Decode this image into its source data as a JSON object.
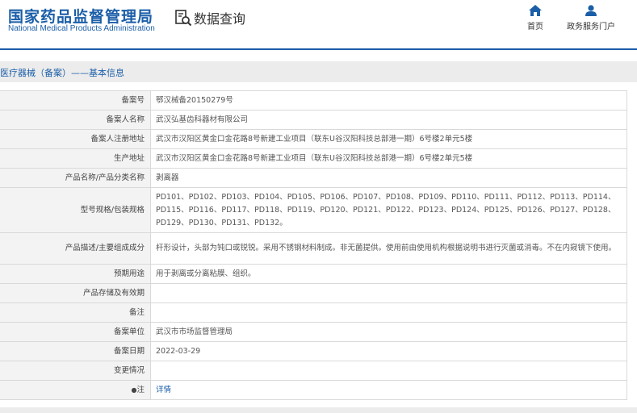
{
  "header": {
    "logo_cn": "国家药品监督管理局",
    "logo_en": "National Medical Products Administration",
    "query_label": "数据查询",
    "nav": [
      {
        "label": "首页",
        "icon": "home-icon"
      },
      {
        "label": "政务服务门户",
        "icon": "user-icon"
      }
    ]
  },
  "breadcrumb": "医疗器械（备案）——基本信息",
  "colors": {
    "brand_blue": "#1b5ea8",
    "label_bg": "#f3f3f3",
    "bar_bg": "#ececec"
  },
  "record": {
    "rows": [
      {
        "label": "备案号",
        "value": "鄂汉械备20150279号"
      },
      {
        "label": "备案人名称",
        "value": "武汉弘基齿科器材有限公司"
      },
      {
        "label": "备案人注册地址",
        "value": "武汉市汉阳区黄金口金花路8号新建工业项目（联东U谷汉阳科技总部港一期）6号楼2单元5楼"
      },
      {
        "label": "生产地址",
        "value": "武汉市汉阳区黄金口金花路8号新建工业项目（联东U谷汉阳科技总部港一期）6号楼2单元5楼"
      },
      {
        "label": "产品名称/产品分类名称",
        "value": "剥离器"
      },
      {
        "label": "型号规格/包装规格",
        "value": "PD101、PD102、PD103、PD104、PD105、PD106、PD107、PD108、PD109、PD110、PD111、PD112、PD113、PD114、PD115、PD116、PD117、PD118、PD119、PD120、PD121、PD122、PD123、PD124、PD125、PD126、PD127、PD128、PD129、PD130、PD131、PD132。"
      },
      {
        "label": "产品描述/主要组成成分",
        "value": "杆形设计，头部为钝口或锐锐。采用不锈钢材料制成。非无菌提供。使用前由使用机构根据说明书进行灭菌或消毒。不在内窥镜下使用。"
      },
      {
        "label": "预期用途",
        "value": "用于剥离或分离粘膜、组织。"
      },
      {
        "label": "产品存储及有效期",
        "value": ""
      },
      {
        "label": "备注",
        "value": ""
      },
      {
        "label": "备案单位",
        "value": "武汉市市场监督管理局"
      },
      {
        "label": "备案日期",
        "value": "2022-03-29"
      },
      {
        "label": "变更情况",
        "value": ""
      }
    ],
    "note_label": "注",
    "note_link": "详情"
  }
}
